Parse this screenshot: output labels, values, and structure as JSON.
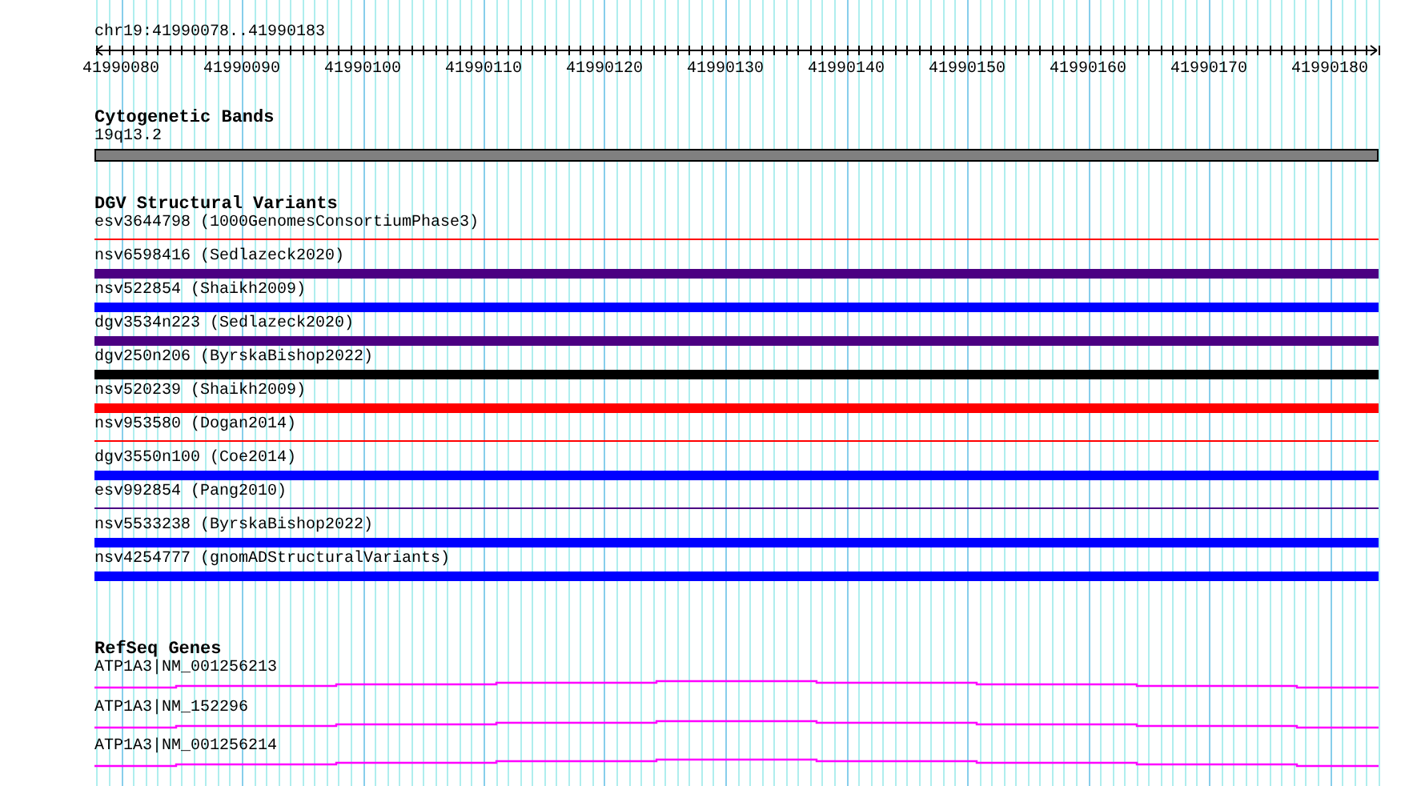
{
  "ruler": {
    "location": "chr19:41990078..41990183",
    "tick_labels": [
      "41990080",
      "41990090",
      "41990100",
      "41990110",
      "41990120",
      "41990130",
      "41990140",
      "41990150",
      "41990160",
      "41990170",
      "41990180"
    ]
  },
  "tracks": [
    {
      "title": "Cytogenetic Bands",
      "features": [
        {
          "label": "19q13.2",
          "kind": "band",
          "color": "#808080"
        }
      ]
    },
    {
      "title": "DGV Structural Variants",
      "features": [
        {
          "label": "esv3644798 (1000GenomesConsortiumPhase3)",
          "kind": "line",
          "color": "#ff0000"
        },
        {
          "label": "nsv6598416 (Sedlazeck2020)",
          "kind": "bar",
          "color": "#4b0082"
        },
        {
          "label": "nsv522854 (Shaikh2009)",
          "kind": "bar",
          "color": "#0000ff"
        },
        {
          "label": "dgv3534n223 (Sedlazeck2020)",
          "kind": "bar",
          "color": "#4b0082"
        },
        {
          "label": "dgv250n206 (ByrskaBishop2022)",
          "kind": "bar",
          "color": "#000000"
        },
        {
          "label": "nsv520239 (Shaikh2009)",
          "kind": "bar",
          "color": "#ff0000"
        },
        {
          "label": "nsv953580 (Dogan2014)",
          "kind": "line",
          "color": "#ff0000"
        },
        {
          "label": "dgv3550n100 (Coe2014)",
          "kind": "bar",
          "color": "#0000ff"
        },
        {
          "label": "esv992854 (Pang2010)",
          "kind": "line",
          "color": "#4b0082"
        },
        {
          "label": "nsv5533238 (ByrskaBishop2022)",
          "kind": "bar",
          "color": "#0000ff"
        },
        {
          "label": "nsv4254777 (gnomADStructuralVariants)",
          "kind": "bar",
          "color": "#0000ff"
        }
      ]
    },
    {
      "title": "RefSeq Genes",
      "features": [
        {
          "label": "ATP1A3|NM_001256213",
          "kind": "gene",
          "color": "#ff00ff"
        },
        {
          "label": "ATP1A3|NM_152296",
          "kind": "gene",
          "color": "#ff00ff"
        },
        {
          "label": "ATP1A3|NM_001256214",
          "kind": "gene",
          "color": "#ff00ff"
        }
      ]
    }
  ]
}
